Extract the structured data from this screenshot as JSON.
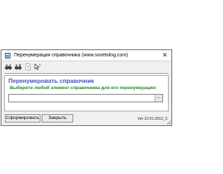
{
  "window": {
    "title": "Перенумерация справочника (www.sovetolog.com)",
    "close_label": "✕"
  },
  "toolbar": {
    "buttons": [
      {
        "icon": "binoculars-find-icon"
      },
      {
        "icon": "binoculars-find-next-icon"
      },
      {
        "icon": "help-page-icon"
      },
      {
        "icon": "pointer-help-icon"
      }
    ]
  },
  "main": {
    "heading": "Перенумеровать справочник",
    "prompt": "Выберите любой элемент справочника для его перенумерации:",
    "field_value": "",
    "browse_label": "..."
  },
  "footer": {
    "form_button": "Сформировать",
    "close_button": "Закрыть",
    "version": "Ver 12.01.2012_3"
  },
  "colors": {
    "heading": "#3a53c0",
    "prompt": "#1e8a1e",
    "window_bg": "#f0f0f0"
  }
}
